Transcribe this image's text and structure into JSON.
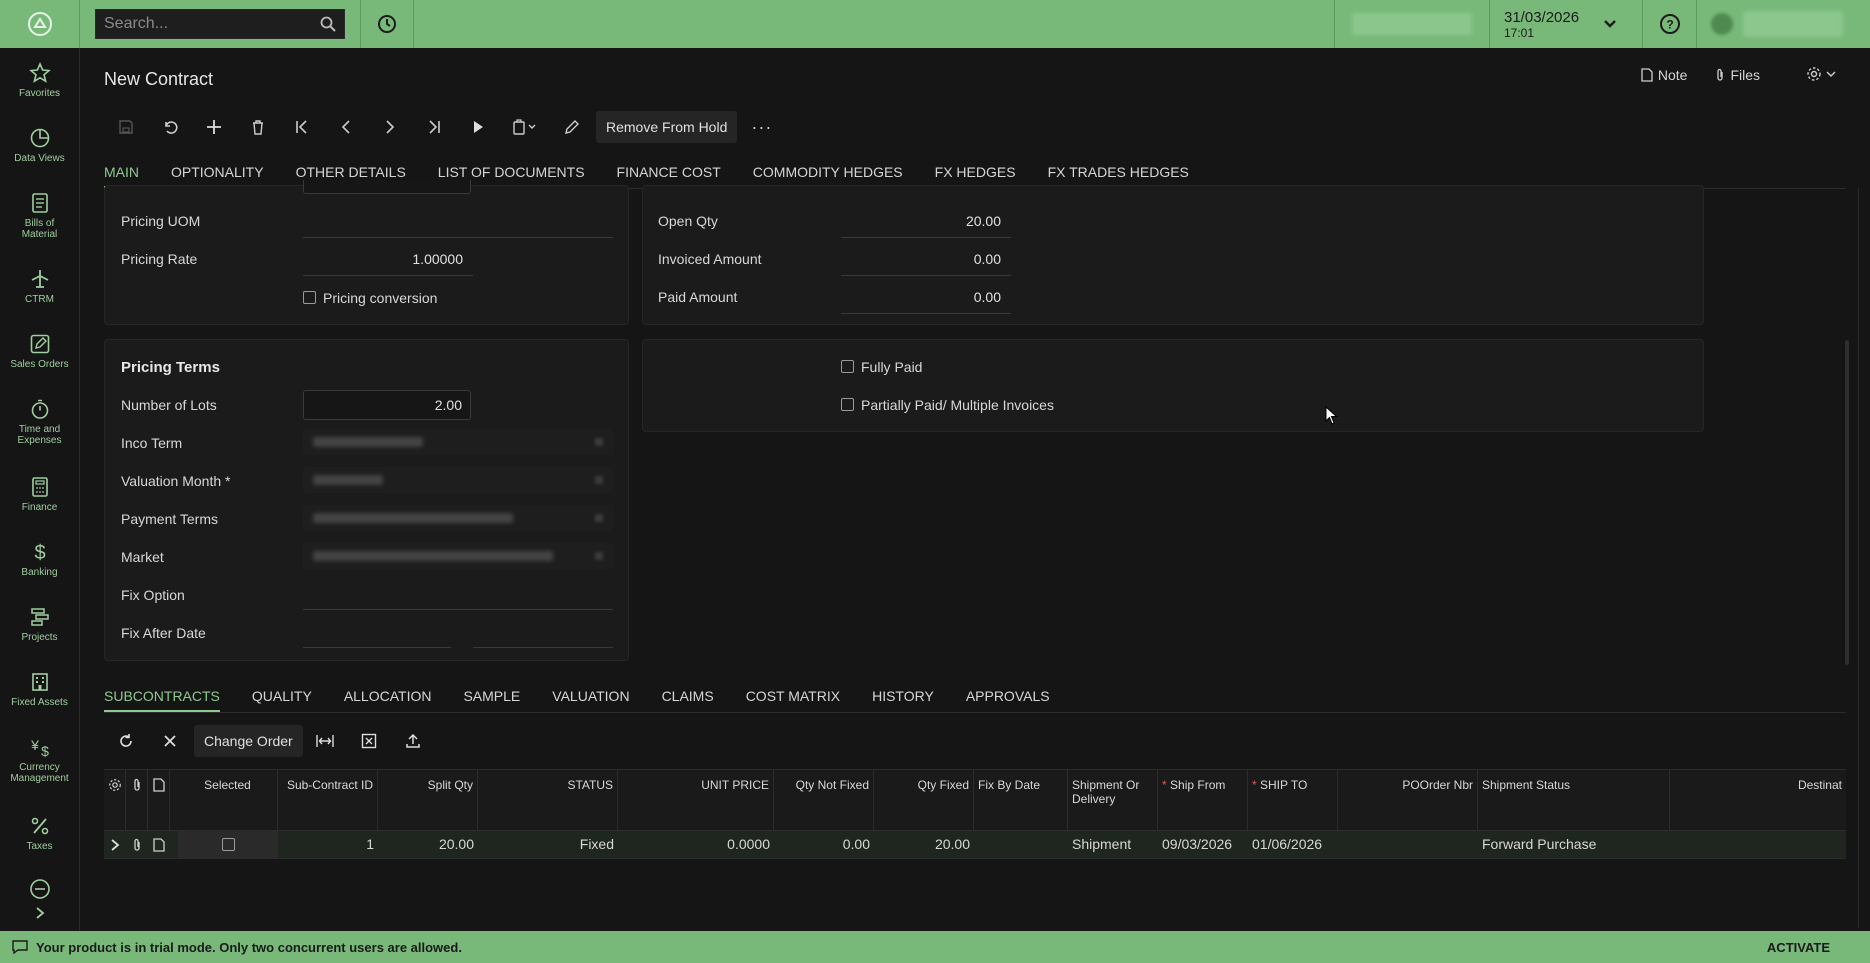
{
  "topbar": {
    "search_placeholder": "Search...",
    "date": "31/03/2026",
    "time": "17:01"
  },
  "sidebar": {
    "items": [
      {
        "label": "Favorites",
        "icon": "star-icon"
      },
      {
        "label": "Data Views",
        "icon": "pie-chart-icon"
      },
      {
        "label": "Bills of Material",
        "icon": "document-list-icon"
      },
      {
        "label": "CTRM",
        "icon": "airplane-icon"
      },
      {
        "label": "Sales Orders",
        "icon": "edit-icon"
      },
      {
        "label": "Time and Expenses",
        "icon": "stopwatch-icon"
      },
      {
        "label": "Finance",
        "icon": "calculator-icon"
      },
      {
        "label": "Banking",
        "icon": "dollar-icon"
      },
      {
        "label": "Projects",
        "icon": "gantt-icon"
      },
      {
        "label": "Fixed Assets",
        "icon": "building-icon"
      },
      {
        "label": "Currency Management",
        "icon": "yen-dollar-icon"
      },
      {
        "label": "Taxes",
        "icon": "percent-icon"
      }
    ]
  },
  "page": {
    "title": "New Contract",
    "note_label": "Note",
    "files_label": "Files",
    "remove_hold_label": "Remove From Hold"
  },
  "tabs": [
    "MAIN",
    "OPTIONALITY",
    "OTHER DETAILS",
    "LIST OF DOCUMENTS",
    "FINANCE COST",
    "COMMODITY HEDGES",
    "FX HEDGES",
    "FX TRADES HEDGES"
  ],
  "form": {
    "pricing_uom_label": "Pricing UOM",
    "pricing_uom_value": "",
    "pricing_rate_label": "Pricing Rate",
    "pricing_rate_value": "1.00000",
    "pricing_conversion_label": "Pricing conversion",
    "open_qty_label": "Open Qty",
    "open_qty_value": "20.00",
    "invoiced_amount_label": "Invoiced Amount",
    "invoiced_amount_value": "0.00",
    "paid_amount_label": "Paid Amount",
    "paid_amount_value": "0.00",
    "pricing_terms_title": "Pricing Terms",
    "number_of_lots_label": "Number of Lots",
    "number_of_lots_value": "2.00",
    "inco_term_label": "Inco Term",
    "valuation_month_label": "Valuation Month *",
    "payment_terms_label": "Payment Terms",
    "market_label": "Market",
    "fix_option_label": "Fix Option",
    "fix_after_date_label": "Fix After Date",
    "fully_paid_label": "Fully Paid",
    "partially_paid_label": "Partially Paid/ Multiple Invoices"
  },
  "bottom_tabs": [
    "SUBCONTRACTS",
    "QUALITY",
    "ALLOCATION",
    "SAMPLE",
    "VALUATION",
    "CLAIMS",
    "COST MATRIX",
    "HISTORY",
    "APPROVALS"
  ],
  "grid": {
    "change_order_label": "Change Order",
    "headers": {
      "selected": "Selected",
      "sub_contract_id": "Sub-Contract ID",
      "split_qty": "Split Qty",
      "status": "STATUS",
      "unit_price": "UNIT PRICE",
      "qty_not_fixed": "Qty Not Fixed",
      "qty_fixed": "Qty Fixed",
      "fix_by_date": "Fix By Date",
      "shipment_or_delivery": "Shipment Or Delivery",
      "ship_from": "Ship From",
      "ship_to": "SHIP TO",
      "poorder_nbr": "POOrder Nbr",
      "shipment_status": "Shipment Status",
      "destination": "Destinat"
    },
    "rows": [
      {
        "sub_contract_id": "1",
        "split_qty": "20.00",
        "status": "Fixed",
        "unit_price": "0.0000",
        "qty_not_fixed": "0.00",
        "qty_fixed": "20.00",
        "fix_by_date": "",
        "shipment_or_delivery": "Shipment",
        "ship_from": "09/03/2026",
        "ship_to": "01/06/2026",
        "poorder_nbr": "",
        "shipment_status": "Forward Purchase"
      }
    ]
  },
  "footer": {
    "message": "Your product is in trial mode. Only two concurrent users are allowed.",
    "activate_label": "ACTIVATE"
  },
  "colors": {
    "accent": "#78b97a",
    "active_tab": "#8fc98f",
    "background": "#151515"
  }
}
